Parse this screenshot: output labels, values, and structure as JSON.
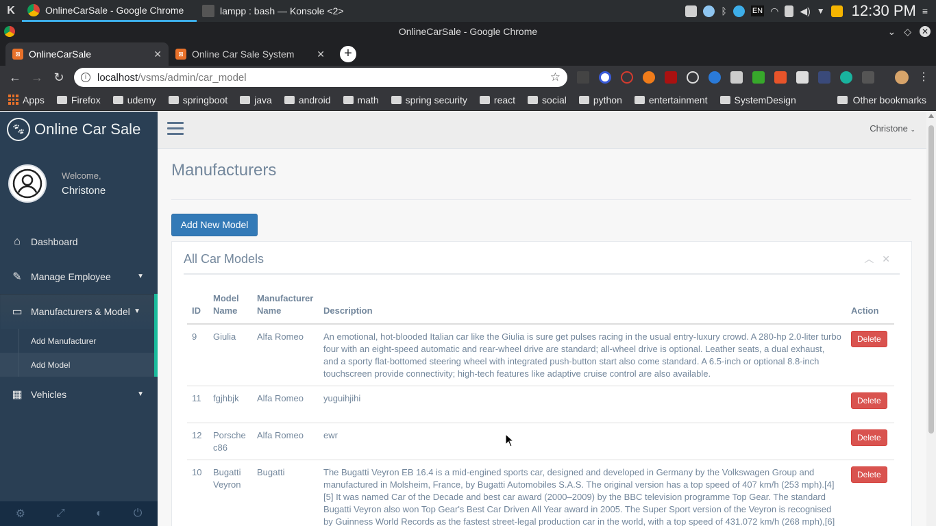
{
  "taskbar": {
    "tasks": [
      "OnlineCarSale - Google Chrome",
      "lampp : bash — Konsole <2>"
    ],
    "clock": "12:30 PM",
    "lang": "EN"
  },
  "browser": {
    "window_title": "OnlineCarSale - Google Chrome",
    "tabs": [
      {
        "label": "OnlineCarSale",
        "active": true
      },
      {
        "label": "Online Car Sale System",
        "active": false
      }
    ],
    "url_host": "localhost",
    "url_path": "/vsms/admin/car_model",
    "bookmarks": [
      "Apps",
      "Firefox",
      "udemy",
      "springboot",
      "java",
      "android",
      "math",
      "spring security",
      "react",
      "social",
      "python",
      "entertainment",
      "SystemDesign"
    ],
    "other_bookmarks": "Other bookmarks"
  },
  "sidebar": {
    "brand": "Online Car Sale",
    "welcome": "Welcome,",
    "username": "Christone",
    "items": [
      {
        "label": "Dashboard",
        "icon": "home-icon"
      },
      {
        "label": "Manage Employee",
        "icon": "edit-icon"
      },
      {
        "label": "Manufacturers & Model",
        "icon": "desktop-icon"
      },
      {
        "label": "Vehicles",
        "icon": "table-icon"
      }
    ],
    "subitems": [
      "Add Manufacturer",
      "Add Model"
    ]
  },
  "topnav": {
    "user": "Christone"
  },
  "page": {
    "title": "Manufacturers",
    "add_button": "Add New Model",
    "panel_title": "All Car Models"
  },
  "table": {
    "headers": {
      "id": "ID",
      "model": "Model Name",
      "manufacturer": "Manufacturer Name",
      "description": "Description",
      "action": "Action"
    },
    "delete_label": "Delete",
    "rows": [
      {
        "id": "9",
        "model": "Giulia",
        "manufacturer": "Alfa Romeo",
        "description": "An emotional, hot-blooded Italian car like the Giulia is sure get pulses racing in the usual entry-luxury crowd. A 280-hp 2.0-liter turbo four with an eight-speed automatic and rear-wheel drive are standard; all-wheel drive is optional. Leather seats, a dual exhaust, and a sporty flat-bottomed steering wheel with integrated push-button start also come standard. A 6.5-inch or optional 8.8-inch touchscreen provide connectivity; high-tech features like adaptive cruise control are also available."
      },
      {
        "id": "11",
        "model": "fgjhbjk",
        "manufacturer": "Alfa Romeo",
        "description": "yuguihjihi"
      },
      {
        "id": "12",
        "model": "Porsche c86",
        "manufacturer": "Alfa Romeo",
        "description": "ewr"
      },
      {
        "id": "10",
        "model": "Bugatti Veyron",
        "manufacturer": "Bugatti",
        "description": "The Bugatti Veyron EB 16.4 is a mid-engined sports car, designed and developed in Germany by the Volkswagen Group and manufactured in Molsheim, France, by Bugatti Automobiles S.A.S. The original version has a top speed of 407 km/h (253 mph).[4][5] It was named Car of the Decade and best car award (2000–2009) by the BBC television programme Top Gear. The standard Bugatti Veyron also won Top Gear's Best Car Driven All Year award in 2005. The Super Sport version of the Veyron is recognised by Guinness World Records as the fastest street-legal production car in the world, with a top speed of 431.072 km/h (268 mph),[6]"
      }
    ]
  }
}
